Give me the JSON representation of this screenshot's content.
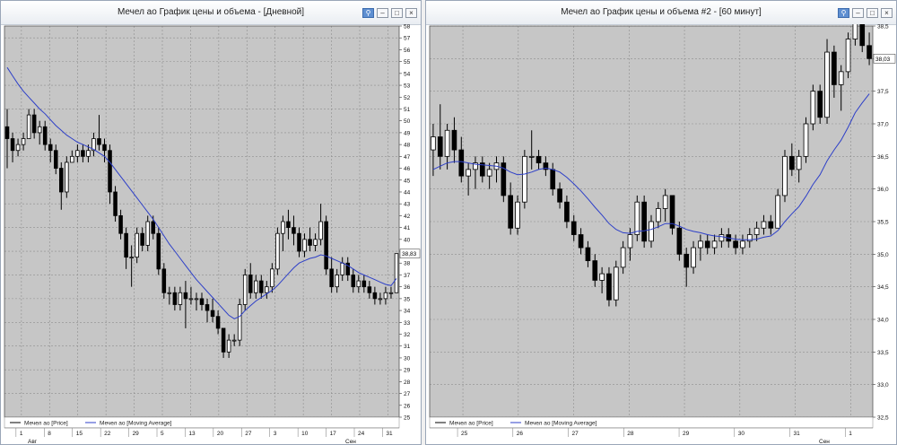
{
  "left_window": {
    "title": "Мечел ао График цены и объема - [Дневной]",
    "legend": [
      "Мечел ао [Price]",
      "Мечел ао [Moving Average]"
    ]
  },
  "right_window": {
    "title": "Мечел ао График цены и объема #2 - [60 минут]",
    "legend": [
      "Мечел ао [Price]",
      "Мечел ао [Moving Average]"
    ]
  },
  "colors": {
    "plot_bg": "#c6c6c6",
    "candle": "#000000",
    "ma_line": "#2d3fc8",
    "grid": "#8e8e8e",
    "last_price_tag": "#ffffff"
  },
  "icons": [
    "link-icon",
    "minimize-icon",
    "maximize-icon",
    "close-icon"
  ],
  "chart_data": [
    {
      "type": "candlestick",
      "ylim": [
        25,
        58
      ],
      "yticks": [
        25,
        26,
        27,
        28,
        29,
        30,
        31,
        32,
        33,
        34,
        35,
        36,
        37,
        38,
        39,
        40,
        41,
        42,
        43,
        44,
        45,
        46,
        47,
        48,
        49,
        50,
        51,
        52,
        53,
        54,
        55,
        56,
        57,
        58
      ],
      "xtick_labels": [
        "1",
        "8",
        "15",
        "22",
        "29",
        "5",
        "13",
        "20",
        "27",
        "3",
        "10",
        "17",
        "24",
        "31"
      ],
      "bottom_labels": [
        "Авг",
        "Сен"
      ],
      "last_price": "38,83",
      "grid": true,
      "ohlc": [
        [
          49.5,
          51,
          46,
          48.5
        ],
        [
          48.5,
          49,
          46.5,
          47.5
        ],
        [
          47.5,
          48.5,
          47,
          48
        ],
        [
          48,
          49,
          47.5,
          48.5
        ],
        [
          48.5,
          51,
          48.5,
          50.5
        ],
        [
          50.5,
          51,
          48.5,
          49
        ],
        [
          49,
          50,
          48,
          49.5
        ],
        [
          49.5,
          50,
          47.5,
          48
        ],
        [
          48,
          48.5,
          46.5,
          47.5
        ],
        [
          47.5,
          48,
          45.5,
          46
        ],
        [
          46,
          46.5,
          42.5,
          44
        ],
        [
          44,
          47,
          43.5,
          46.5
        ],
        [
          46.5,
          47.5,
          46.5,
          47
        ],
        [
          47,
          48,
          46.5,
          47.5
        ],
        [
          47.5,
          48,
          46.5,
          47
        ],
        [
          47,
          48,
          46.5,
          47.5
        ],
        [
          47.5,
          49,
          47,
          48.5
        ],
        [
          48.5,
          50.5,
          47.5,
          48
        ],
        [
          48,
          48.5,
          46.5,
          47.5
        ],
        [
          47.5,
          48,
          43,
          44
        ],
        [
          44,
          44.5,
          41.5,
          42
        ],
        [
          42,
          42.5,
          40,
          40.5
        ],
        [
          40.5,
          41,
          37.5,
          38.5
        ],
        [
          38.5,
          39.5,
          36,
          38.5
        ],
        [
          38.5,
          41,
          38,
          40.5
        ],
        [
          40.5,
          41,
          39,
          39.5
        ],
        [
          39.5,
          42,
          39,
          41.5
        ],
        [
          41.5,
          42,
          40,
          40.5
        ],
        [
          40.5,
          41,
          37,
          37.5
        ],
        [
          37.5,
          38,
          35,
          35.5
        ],
        [
          35.5,
          36,
          34.5,
          35.5
        ],
        [
          35.5,
          36,
          34,
          34.5
        ],
        [
          34.5,
          36,
          34,
          35.5
        ],
        [
          35.5,
          36.5,
          32.5,
          35
        ],
        [
          35,
          36,
          34.5,
          35
        ],
        [
          35,
          35.5,
          34,
          35
        ],
        [
          35,
          35.5,
          34,
          34.5
        ],
        [
          34.5,
          35,
          33,
          34
        ],
        [
          34,
          35,
          33,
          33.5
        ],
        [
          33.5,
          34,
          32,
          32.5
        ],
        [
          32.5,
          32.5,
          30,
          30.5
        ],
        [
          30.5,
          32,
          30,
          31.5
        ],
        [
          31.5,
          32,
          31,
          31.5
        ],
        [
          31.5,
          35,
          31,
          34.5
        ],
        [
          34.5,
          37.5,
          34,
          37
        ],
        [
          37,
          38,
          35,
          35.5
        ],
        [
          35.5,
          37,
          35,
          36.5
        ],
        [
          36.5,
          37,
          35,
          35.5
        ],
        [
          35.5,
          36.5,
          35,
          36
        ],
        [
          36,
          38,
          35.5,
          37.5
        ],
        [
          37.5,
          41,
          37,
          40.5
        ],
        [
          40.5,
          42,
          39,
          41.5
        ],
        [
          41.5,
          42.5,
          40,
          41
        ],
        [
          41,
          42,
          39.5,
          40.5
        ],
        [
          40.5,
          41,
          38.5,
          39
        ],
        [
          39,
          40.5,
          38.5,
          40
        ],
        [
          40,
          41,
          39,
          39.5
        ],
        [
          39.5,
          40.5,
          39,
          40
        ],
        [
          40,
          43,
          39.5,
          41.5
        ],
        [
          41.5,
          42,
          37,
          37.5
        ],
        [
          37.5,
          38.5,
          35.5,
          36
        ],
        [
          36,
          37.5,
          35.5,
          37
        ],
        [
          37,
          38.5,
          36.5,
          38
        ],
        [
          38,
          38.5,
          36.5,
          37
        ],
        [
          37,
          37.5,
          35.5,
          36
        ],
        [
          36,
          37,
          35.5,
          36.5
        ],
        [
          36.5,
          37,
          35.5,
          36
        ],
        [
          36,
          36.5,
          35,
          35.5
        ],
        [
          35.5,
          36,
          34.5,
          35
        ],
        [
          35,
          35.5,
          34.5,
          35
        ],
        [
          35,
          36,
          34.5,
          35.5
        ],
        [
          35.5,
          36,
          35,
          35.5
        ],
        [
          35.5,
          38.8,
          35.5,
          38.8
        ]
      ],
      "series": [
        {
          "name": "Мечел ао [Moving Average]",
          "values": [
            54.5,
            53.8,
            53.1,
            52.5,
            52,
            51.5,
            51,
            50.6,
            50.1,
            49.6,
            49.2,
            48.8,
            48.5,
            48.2,
            48,
            47.8,
            47.6,
            47.3,
            47,
            46.5,
            45.9,
            45.3,
            44.7,
            44.1,
            43.5,
            42.9,
            42.3,
            41.7,
            41,
            40.3,
            39.6,
            39,
            38.4,
            37.8,
            37.2,
            36.6,
            36.1,
            35.6,
            35.1,
            34.6,
            34.1,
            33.6,
            33.3,
            33.5,
            34,
            34.4,
            34.8,
            35.1,
            35.4,
            35.7,
            36.1,
            36.6,
            37.1,
            37.6,
            38,
            38.2,
            38.4,
            38.5,
            38.7,
            38.6,
            38.4,
            38.2,
            38,
            37.8,
            37.5,
            37.2,
            37,
            36.8,
            36.6,
            36.4,
            36.2,
            36.1,
            36.7
          ]
        }
      ]
    },
    {
      "type": "candlestick",
      "ylim": [
        32.5,
        38.5
      ],
      "yticks": [
        32.5,
        33,
        33.5,
        34,
        34.5,
        35,
        35.5,
        36,
        36.5,
        37,
        37.5,
        38,
        38.5
      ],
      "xtick_labels": [
        "25",
        "26",
        "27",
        "28",
        "29",
        "30",
        "31",
        "1"
      ],
      "bottom_labels": [
        "Сен"
      ],
      "last_price": "38,03",
      "grid": true,
      "ohlc": [
        [
          36.6,
          37,
          36.2,
          36.8
        ],
        [
          36.8,
          37.3,
          36.3,
          36.5
        ],
        [
          36.5,
          37,
          36.3,
          36.9
        ],
        [
          36.9,
          37.1,
          36.4,
          36.6
        ],
        [
          36.6,
          36.8,
          36.1,
          36.2
        ],
        [
          36.2,
          36.4,
          35.9,
          36.3
        ],
        [
          36.3,
          36.5,
          36,
          36.4
        ],
        [
          36.4,
          36.5,
          36.1,
          36.2
        ],
        [
          36.2,
          36.4,
          36,
          36.3
        ],
        [
          36.3,
          36.5,
          36.1,
          36.4
        ],
        [
          36.4,
          36.5,
          35.8,
          35.9
        ],
        [
          35.9,
          36.1,
          35.3,
          35.4
        ],
        [
          35.4,
          35.9,
          35.3,
          35.8
        ],
        [
          35.8,
          36.6,
          35.7,
          36.5
        ],
        [
          36.5,
          36.9,
          36.3,
          36.5
        ],
        [
          36.5,
          36.6,
          36.3,
          36.4
        ],
        [
          36.4,
          36.5,
          36.2,
          36.3
        ],
        [
          36.3,
          36.4,
          35.9,
          36
        ],
        [
          36,
          36.1,
          35.7,
          35.8
        ],
        [
          35.8,
          35.9,
          35.4,
          35.5
        ],
        [
          35.5,
          35.6,
          35.2,
          35.3
        ],
        [
          35.3,
          35.4,
          35,
          35.1
        ],
        [
          35.1,
          35.2,
          34.8,
          34.9
        ],
        [
          34.9,
          35,
          34.5,
          34.6
        ],
        [
          34.6,
          34.8,
          34.4,
          34.7
        ],
        [
          34.7,
          34.8,
          34.2,
          34.3
        ],
        [
          34.3,
          34.9,
          34.2,
          34.8
        ],
        [
          34.8,
          35.2,
          34.7,
          35.1
        ],
        [
          35.1,
          35.4,
          34.9,
          35.3
        ],
        [
          35.3,
          35.9,
          35.2,
          35.8
        ],
        [
          35.8,
          35.9,
          35.1,
          35.2
        ],
        [
          35.2,
          35.6,
          35.1,
          35.5
        ],
        [
          35.5,
          35.8,
          35.4,
          35.7
        ],
        [
          35.7,
          36,
          35.5,
          35.9
        ],
        [
          35.9,
          35.9,
          35.3,
          35.4
        ],
        [
          35.4,
          35.5,
          34.9,
          35
        ],
        [
          35,
          35.1,
          34.5,
          34.8
        ],
        [
          34.8,
          35.2,
          34.7,
          35.1
        ],
        [
          35.1,
          35.3,
          34.9,
          35.2
        ],
        [
          35.2,
          35.3,
          35,
          35.1
        ],
        [
          35.1,
          35.3,
          35,
          35.2
        ],
        [
          35.2,
          35.4,
          35.1,
          35.3
        ],
        [
          35.3,
          35.4,
          35.1,
          35.2
        ],
        [
          35.2,
          35.3,
          35,
          35.1
        ],
        [
          35.1,
          35.3,
          35,
          35.2
        ],
        [
          35.2,
          35.4,
          35.1,
          35.3
        ],
        [
          35.3,
          35.5,
          35.2,
          35.4
        ],
        [
          35.4,
          35.6,
          35.3,
          35.5
        ],
        [
          35.5,
          35.6,
          35.3,
          35.4
        ],
        [
          35.4,
          36,
          35.4,
          35.9
        ],
        [
          35.9,
          36.6,
          35.8,
          36.5
        ],
        [
          36.5,
          36.7,
          36.2,
          36.3
        ],
        [
          36.3,
          36.6,
          36.1,
          36.5
        ],
        [
          36.5,
          37.1,
          36.4,
          37
        ],
        [
          37,
          37.6,
          36.9,
          37.5
        ],
        [
          37.5,
          37.6,
          37,
          37.1
        ],
        [
          37.1,
          38.3,
          37,
          38.1
        ],
        [
          38.1,
          38.2,
          37.4,
          37.6
        ],
        [
          37.6,
          37.9,
          37.2,
          37.8
        ],
        [
          37.8,
          38.4,
          37.7,
          38.3
        ],
        [
          38.3,
          38.8,
          38.2,
          38.6
        ],
        [
          38.6,
          38.7,
          38.1,
          38.2
        ],
        [
          38.2,
          38.4,
          37.9,
          38
        ]
      ],
      "series": [
        {
          "name": "Мечел ао [Moving Average]",
          "values": [
            36.3,
            36.35,
            36.4,
            36.42,
            36.42,
            36.4,
            36.38,
            36.37,
            36.36,
            36.35,
            36.32,
            36.26,
            36.22,
            36.23,
            36.26,
            36.3,
            36.32,
            36.3,
            36.26,
            36.18,
            36.08,
            35.97,
            35.85,
            35.72,
            35.6,
            35.47,
            35.38,
            35.33,
            35.32,
            35.35,
            35.36,
            35.38,
            35.42,
            35.47,
            35.47,
            35.43,
            35.38,
            35.35,
            35.33,
            35.3,
            35.28,
            35.27,
            35.25,
            35.23,
            35.22,
            35.22,
            35.23,
            35.26,
            35.28,
            35.36,
            35.5,
            35.62,
            35.73,
            35.89,
            36.07,
            36.22,
            36.43,
            36.6,
            36.75,
            36.95,
            37.17,
            37.32,
            37.46
          ]
        }
      ]
    }
  ]
}
